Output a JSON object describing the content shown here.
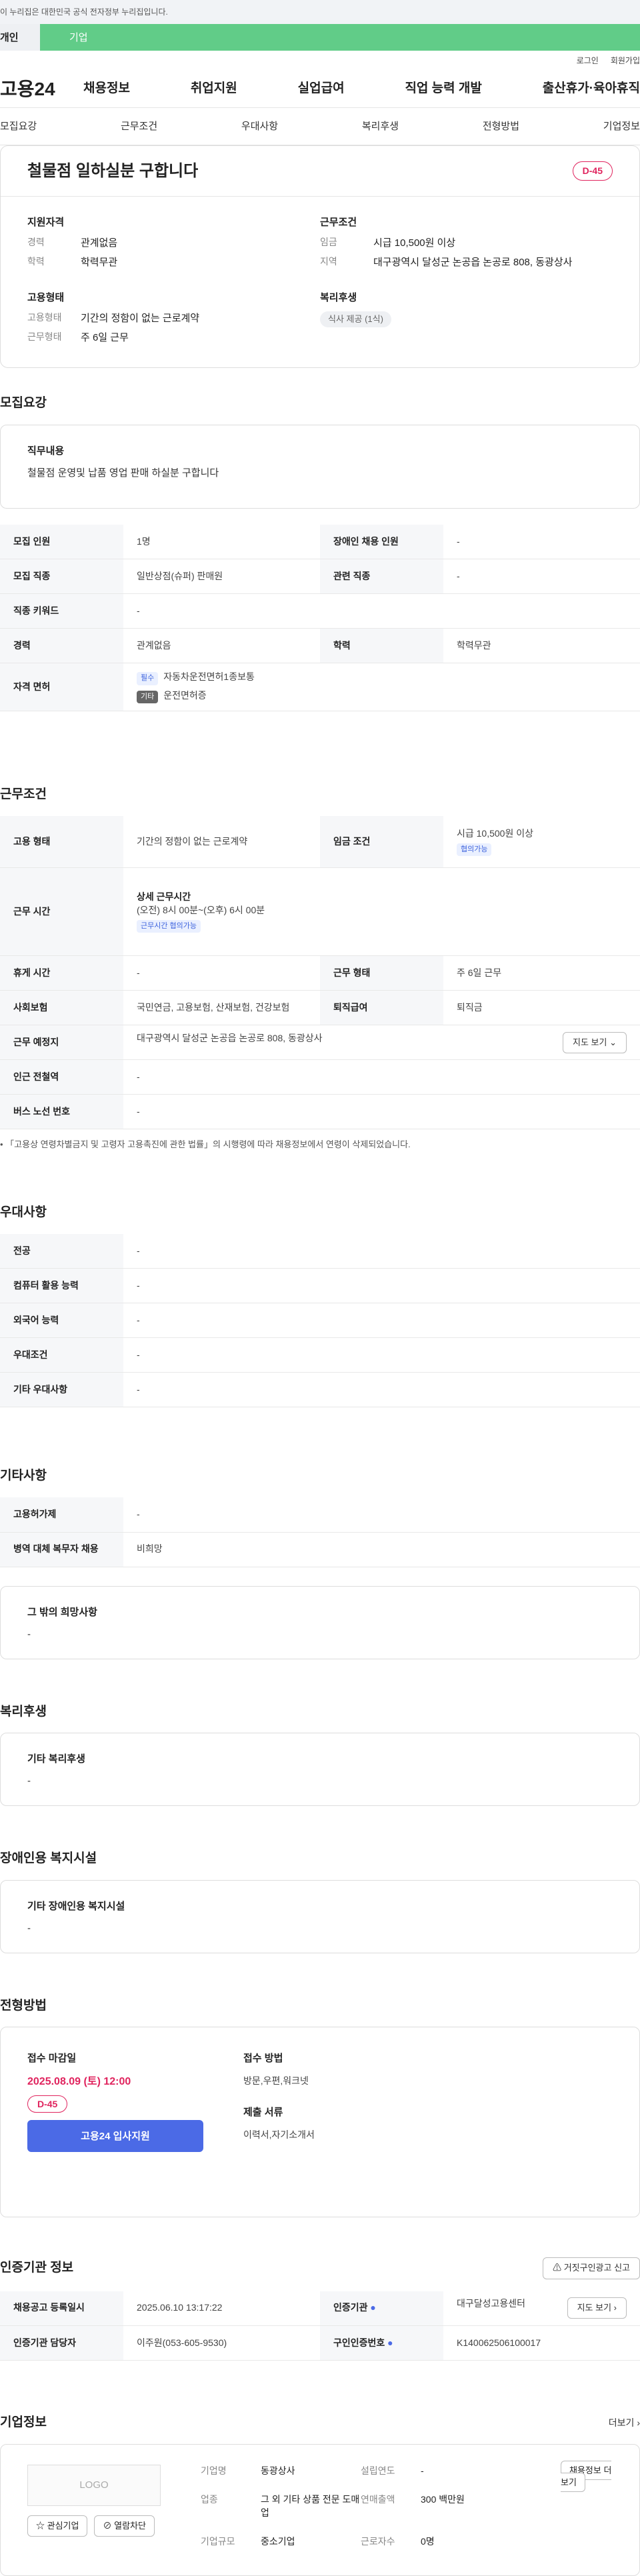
{
  "topbar": {
    "notice": "이 누리집은 대한민국 공식 전자정부 누리집입니다."
  },
  "tabs": {
    "personal": "개인",
    "corporate": "기업"
  },
  "util": {
    "login": "로그인",
    "join": "회원가입"
  },
  "gnb": {
    "logo": "고용24",
    "menu": [
      "채용정보",
      "취업지원",
      "실업급여",
      "직업 능력 개발",
      "출산휴가·육아휴직"
    ]
  },
  "subnav": [
    "모집요강",
    "근무조건",
    "우대사항",
    "복리후생",
    "전형방법",
    "기업정보"
  ],
  "summary": {
    "title": "철물점 일하실분 구합니다",
    "dday": "D-45",
    "qual_title": "지원자격",
    "qual": [
      {
        "k": "경력",
        "v": "관계없음"
      },
      {
        "k": "학력",
        "v": "학력무관"
      }
    ],
    "cond_title": "근무조건",
    "cond": [
      {
        "k": "임금",
        "v": "시급 10,500원 이상"
      },
      {
        "k": "지역",
        "v": "대구광역시 달성군 논공읍 논공로 808, 동광상사"
      }
    ],
    "emp_title": "고용형태",
    "emp": [
      {
        "k": "고용형태",
        "v": "기간의 정함이 없는 근로계약"
      },
      {
        "k": "근무형태",
        "v": "주 6일 근무"
      }
    ],
    "welfare_title": "복리후생",
    "welfare_tag": "식사 제공 (1식)"
  },
  "recruit": {
    "title": "모집요강",
    "duty_title": "직무내용",
    "duty": "철물점 운영및 납품 영업 판매 하실분 구합니다",
    "rows": [
      {
        "k1": "모집 인원",
        "v1": "1명",
        "k2": "장애인 채용 인원",
        "v2": "-"
      },
      {
        "k1": "모집 직종",
        "v1": "일반상점(슈퍼) 판매원",
        "k2": "관련 직종",
        "v2": "-"
      },
      {
        "k1": "직종 키워드",
        "v1": "-"
      },
      {
        "k1": "경력",
        "v1": "관계없음",
        "k2": "학력",
        "v2": "학력무관"
      }
    ],
    "license_label": "자격 면허",
    "license": [
      {
        "tag": "필수",
        "v": "자동차운전면허1종보통"
      },
      {
        "tag": "기타",
        "v": "운전면허증"
      }
    ]
  },
  "work": {
    "title": "근무조건",
    "emp_label": "고용 형태",
    "emp": "기간의 정함이 없는 근로계약",
    "wage_label": "임금 조건",
    "wage": "시급 10,500원 이상",
    "wage_tag": "협의가능",
    "time_label": "근무 시간",
    "time_title": "상세 근무시간",
    "time": "(오전) 8시 00분~(오후) 6시 00분",
    "time_tag": "근무시간 협의가능",
    "rest_label": "휴게 시간",
    "rest": "-",
    "form_label": "근무 형태",
    "form": "주 6일 근무",
    "ins_label": "사회보험",
    "ins": "국민연금, 고용보험, 산재보험, 건강보험",
    "sev_label": "퇴직급여",
    "sev": "퇴직금",
    "place_label": "근무 예정지",
    "place": "대구광역시 달성군 논공읍 논공로 808, 동광상사",
    "map_btn": "지도 보기",
    "subway_label": "인근 전철역",
    "subway": "-",
    "bus_label": "버스 노선 번호",
    "bus": "-",
    "note": "「고용상 연령차별금지 및 고령자 고용촉진에 관한 법률」의 시행령에 따라 채용정보에서 연령이 삭제되었습니다."
  },
  "pref": {
    "title": "우대사항",
    "rows": [
      {
        "k": "전공",
        "v": "-"
      },
      {
        "k": "컴퓨터 활용 능력",
        "v": "-"
      },
      {
        "k": "외국어 능력",
        "v": "-"
      },
      {
        "k": "우대조건",
        "v": "-"
      },
      {
        "k": "기타 우대사항",
        "v": "-"
      }
    ]
  },
  "etc": {
    "title": "기타사항",
    "rows": [
      {
        "k": "고용허가제",
        "v": "-"
      },
      {
        "k": "병역 대체 복무자 채용",
        "v": "비희망"
      }
    ],
    "box_title": "그 밖의 희망사항",
    "box_v": "-"
  },
  "welfare": {
    "title": "복리후생",
    "box_title": "기타 복리후생",
    "box_v": "-"
  },
  "disability": {
    "title": "장애인용 복지시설",
    "box_title": "기타 장애인용 복지시설",
    "box_v": "-"
  },
  "apply": {
    "title": "전형방법",
    "deadline_title": "접수 마감일",
    "deadline": "2025.08.09 (토) 12:00",
    "dday": "D-45",
    "apply_btn": "고용24 입사지원",
    "method_title": "접수 방법",
    "method": "방문,우편,워크넷",
    "docs_title": "제출 서류",
    "docs": "이력서,자기소개서"
  },
  "cert": {
    "title": "인증기관 정보",
    "report_btn": "거짓구인광고 신고",
    "r1k1": "채용공고 등록일시",
    "r1v1": "2025.06.10 13:17:22",
    "r1k2": "인증기관",
    "r1v2": "대구달성고용센터",
    "map_btn": "지도 보기",
    "r2k1": "인증기관 담당자",
    "r2v1": "이주원(053-605-9530)",
    "r2k2": "구인인증번호",
    "r2v2": "K140062506100017"
  },
  "company": {
    "title": "기업정보",
    "more": "더보기",
    "logo": "LOGO",
    "fav_btn": "관심기업",
    "block_btn": "열람차단",
    "name_k": "기업명",
    "name_v": "동광상사",
    "year_k": "설립연도",
    "year_v": "-",
    "biz_k": "업종",
    "biz_v": "그 외 기타 상품 전문 도매업",
    "sales_k": "연매출액",
    "sales_v": "300 백만원",
    "emp_k": "근로자수",
    "emp_v": "0명",
    "size_k": "기업규모",
    "size_v": "중소기업",
    "jobs_btn": "채용정보 더보기"
  }
}
